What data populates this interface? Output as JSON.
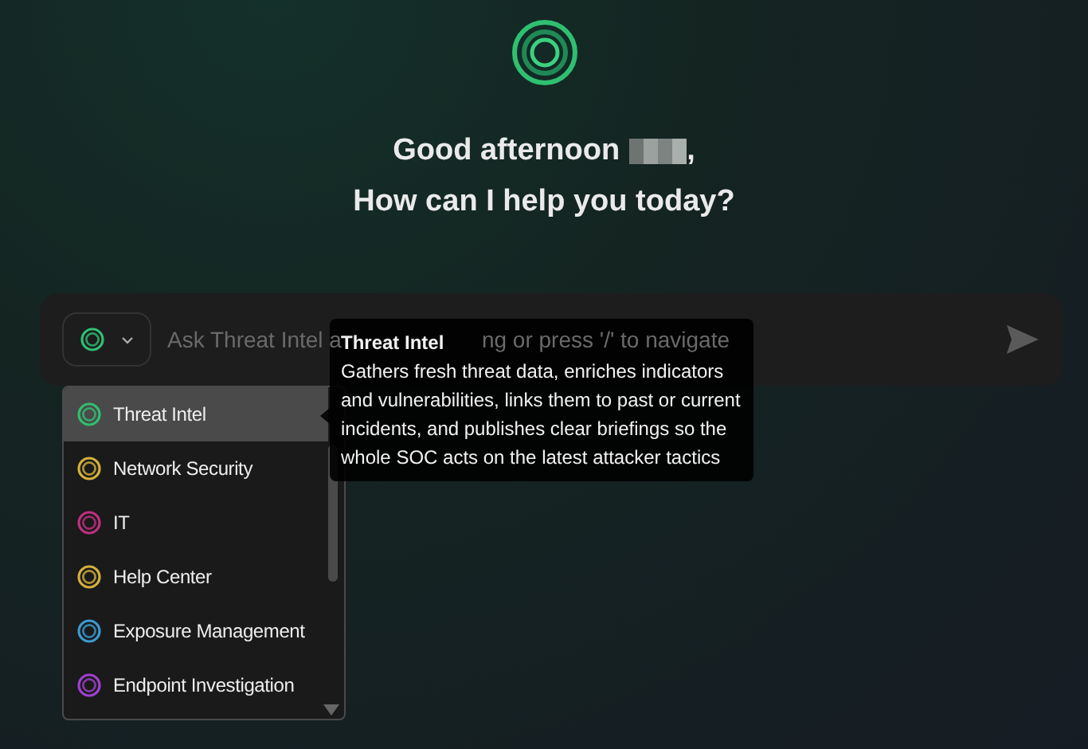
{
  "greeting": {
    "prefix": "Good afternoon",
    "suffix": ",",
    "question": "How can I help you today?"
  },
  "prompt": {
    "placeholder_parts": [
      "Ask Threat Intel a",
      "ng or press '/' to navigate"
    ]
  },
  "agents": [
    {
      "label": "Threat Intel",
      "color": "#2fbf71",
      "selected": true
    },
    {
      "label": "Network Security",
      "color": "#d4b13a",
      "selected": false
    },
    {
      "label": "IT",
      "color": "#c0307f",
      "selected": false
    },
    {
      "label": "Help Center",
      "color": "#d4b13a",
      "selected": false
    },
    {
      "label": "Exposure Management",
      "color": "#3a9bd0",
      "selected": false
    },
    {
      "label": "Endpoint Investigation",
      "color": "#a040d0",
      "selected": false
    }
  ],
  "tooltip": {
    "title": "Threat Intel",
    "body": "Gathers fresh threat data, enriches indicators and vulnerabilities, links them to past or current incidents, and publishes clear briefings so the whole SOC acts on the latest attacker tactics"
  }
}
